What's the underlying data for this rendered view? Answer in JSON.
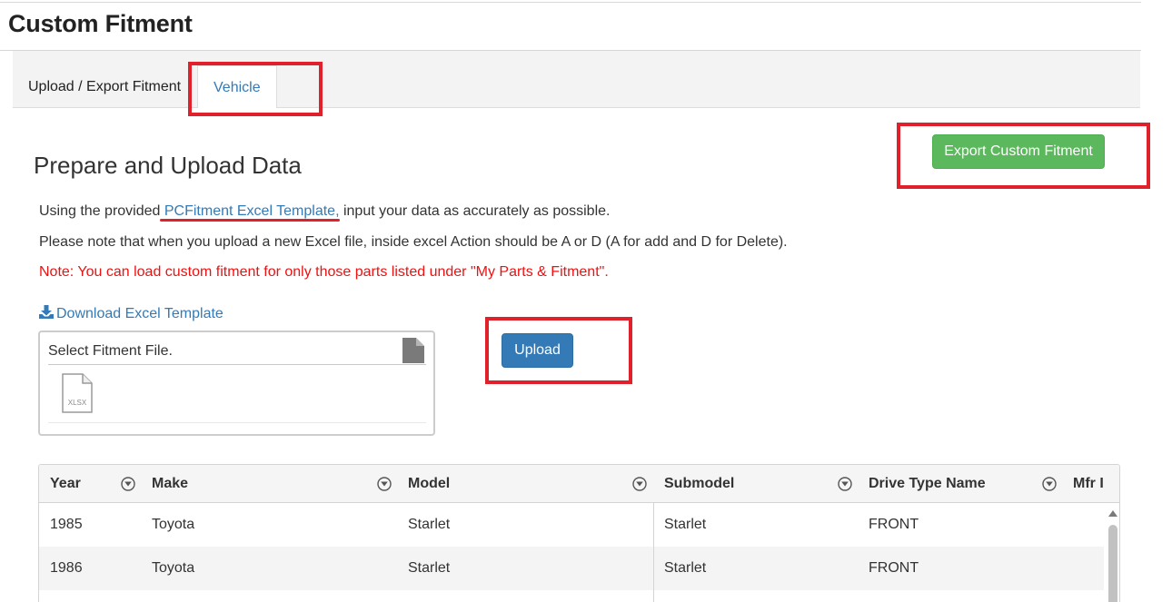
{
  "page": {
    "title": "Custom Fitment"
  },
  "tabs": [
    {
      "label": "Upload / Export Fitment"
    },
    {
      "label": "Vehicle"
    }
  ],
  "section": {
    "title": "Prepare and Upload Data",
    "line1_prefix": "Using the provided ",
    "line1_link": "PCFitment Excel Template,",
    "line1_suffix": " input your data as accurately as possible.",
    "line2": "Please note that when you upload a new Excel file, inside excel Action should be A or D (A for add and D for Delete).",
    "note": "Note: You can load custom fitment for only those parts listed under \"My Parts & Fitment\"."
  },
  "download": {
    "label": "Download Excel Template"
  },
  "file_picker": {
    "label": "Select Fitment File.",
    "file_type": "XLSX"
  },
  "buttons": {
    "upload": "Upload",
    "export": "Export Custom Fitment"
  },
  "grid": {
    "columns": [
      "Year",
      "Make",
      "Model",
      "Submodel",
      "Drive Type Name",
      "Mfr I"
    ],
    "rows": [
      [
        "1985",
        "Toyota",
        "Starlet",
        "Starlet",
        "FRONT"
      ],
      [
        "1986",
        "Toyota",
        "Starlet",
        "Starlet",
        "FRONT"
      ]
    ]
  },
  "colors": {
    "primary_button": "#337ab7",
    "export_button": "#5cb85c",
    "note_text": "#ee1111",
    "annotation": "#e0202a"
  }
}
